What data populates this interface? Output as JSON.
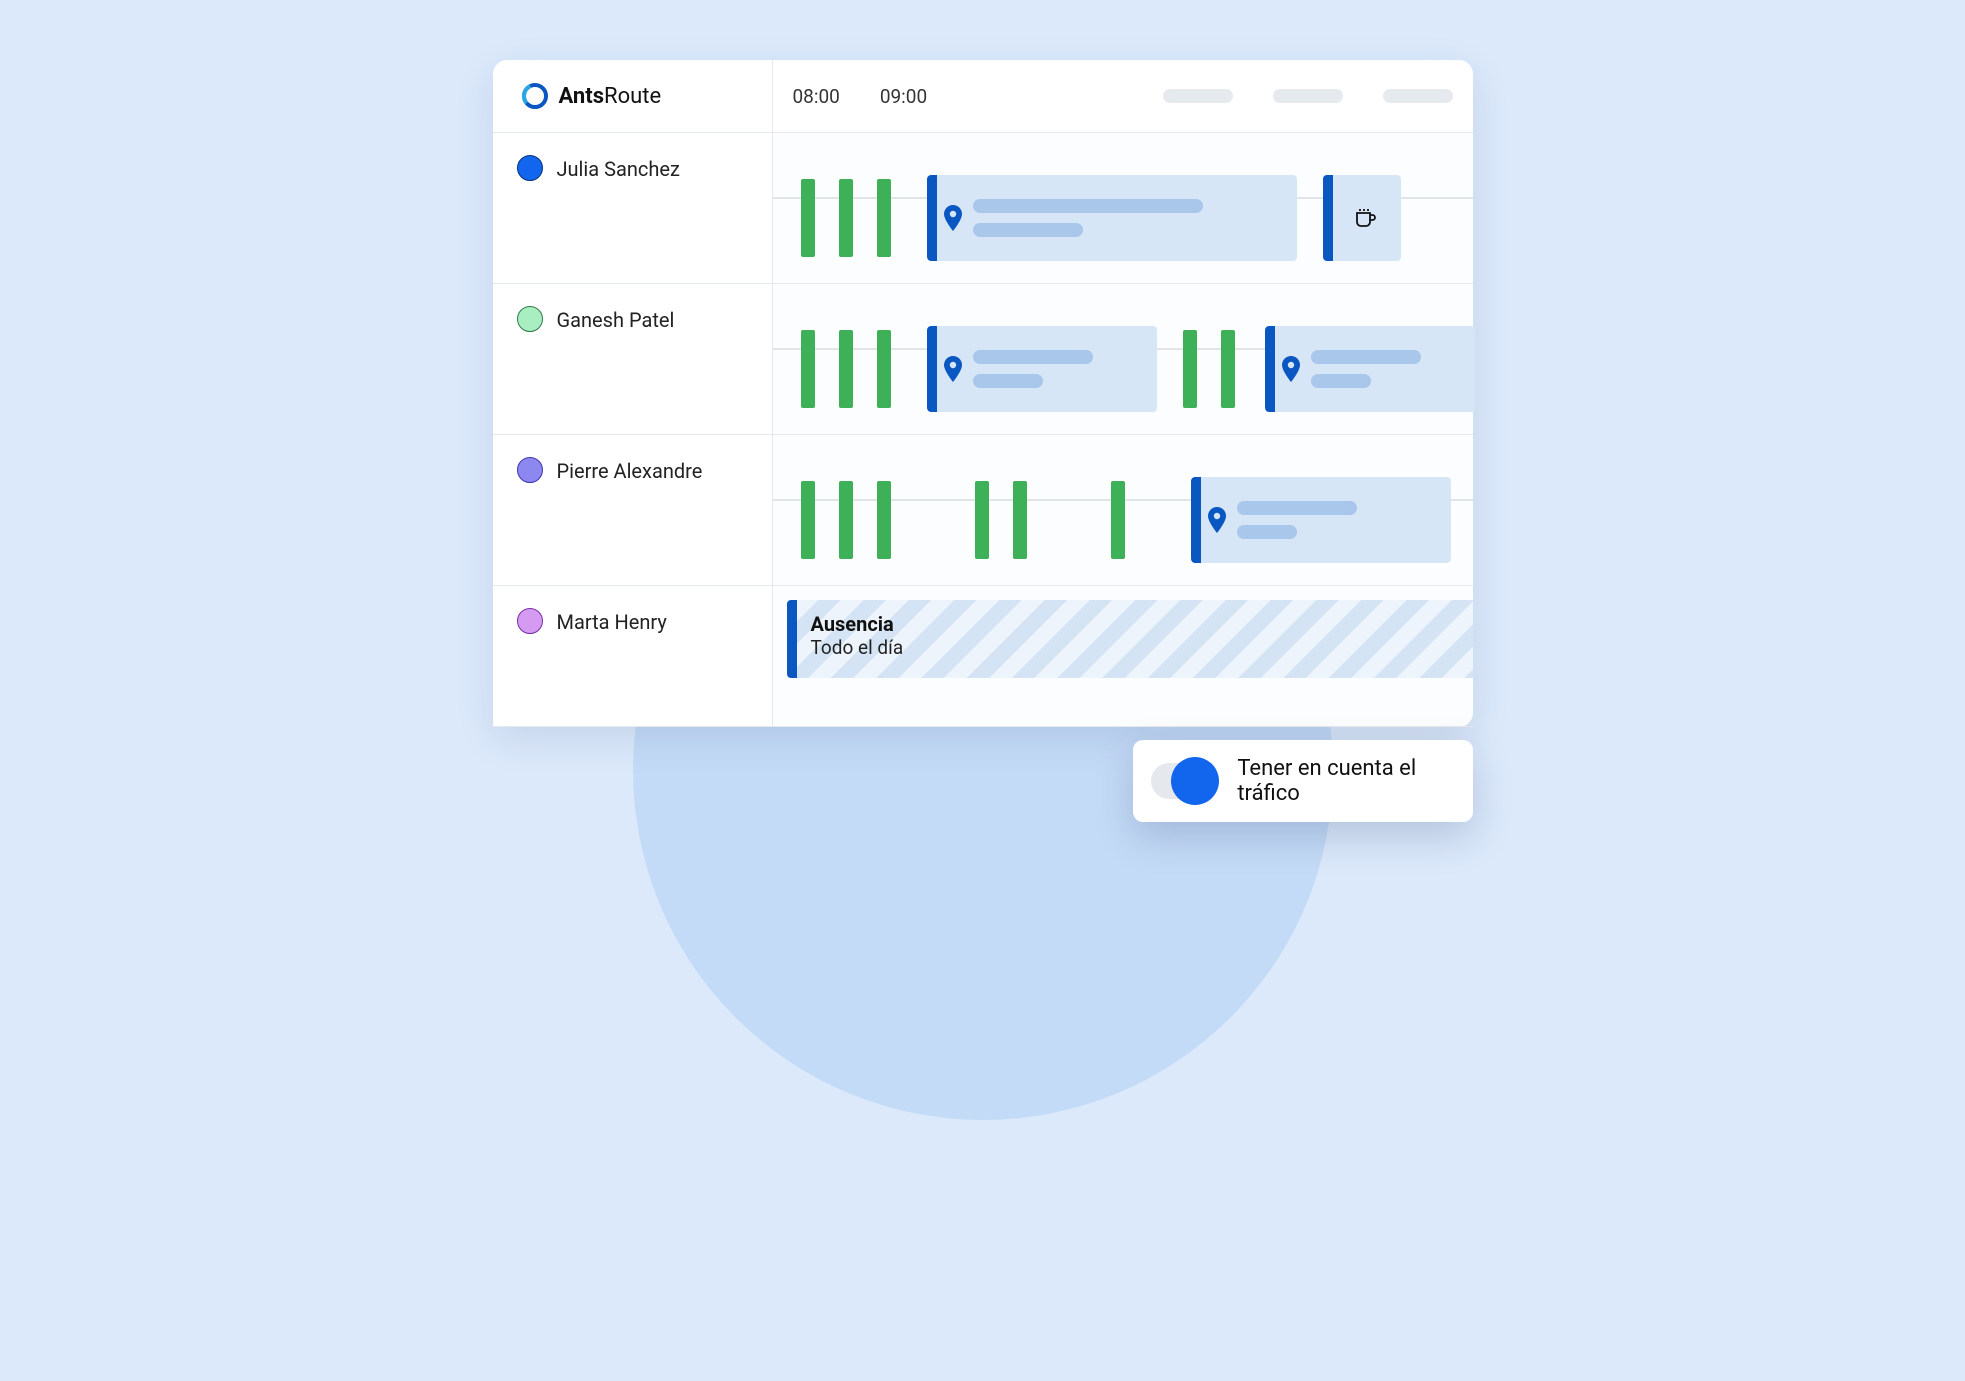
{
  "brand": {
    "bold": "Ants",
    "light": "Route"
  },
  "timeline": {
    "times": [
      "08:00",
      "09:00"
    ]
  },
  "agents": [
    {
      "name": "Julia Sanchez",
      "dot_fill": "#1266ee",
      "dot_stroke": "#06327a"
    },
    {
      "name": "Ganesh Patel",
      "dot_fill": "#a9eec0",
      "dot_stroke": "#2f7a48"
    },
    {
      "name": "Pierre Alexandre",
      "dot_fill": "#8c88f0",
      "dot_stroke": "#3c36b0"
    },
    {
      "name": "Marta Henry",
      "dot_fill": "#d59bf3",
      "dot_stroke": "#7a2fa8"
    }
  ],
  "absence": {
    "title": "Ausencia",
    "subtitle": "Todo el día"
  },
  "toggle": {
    "label": "Tener en cuenta el tráfico",
    "on": true
  }
}
